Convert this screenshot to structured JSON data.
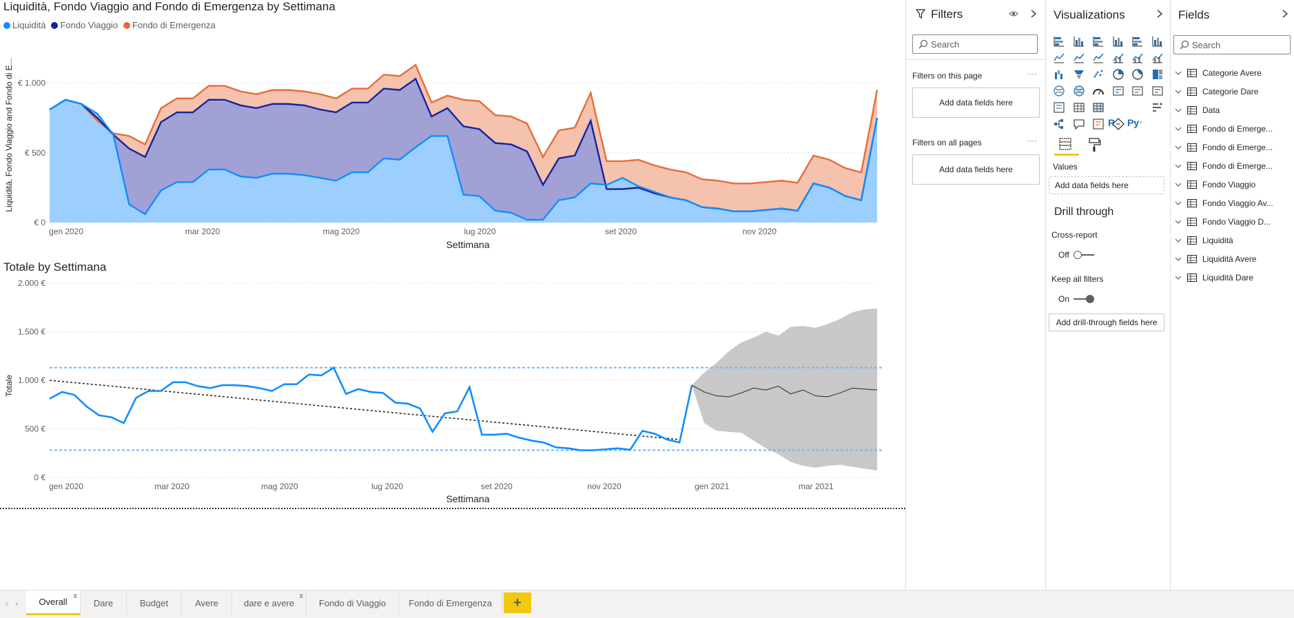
{
  "charts": {
    "top": {
      "title": "Liquidità, Fondo Viaggio and Fondo di Emergenza by Settimana",
      "xlabel": "Settimana",
      "ylabel": "Liquidità, Fondo Viaggio and Fondo di E...",
      "legend": [
        "Liquidità",
        "Fondo Viaggio",
        "Fondo di Emergenza"
      ],
      "yticks": [
        "€ 1.000",
        "€ 500",
        "€ 0"
      ],
      "xticks": [
        "gen 2020",
        "mar 2020",
        "mag 2020",
        "lug 2020",
        "set 2020",
        "nov 2020"
      ]
    },
    "bottom": {
      "title": "Totale by Settimana",
      "xlabel": "Settimana",
      "ylabel": "Totale",
      "yticks": [
        "2.000 €",
        "1.500 €",
        "1.000 €",
        "500 €",
        "0 €"
      ],
      "xticks": [
        "gen 2020",
        "mar 2020",
        "mag 2020",
        "lug 2020",
        "set 2020",
        "nov 2020",
        "gen 2021",
        "mar 2021"
      ]
    }
  },
  "chart_data": [
    {
      "type": "area",
      "title": "Liquidità, Fondo Viaggio and Fondo di Emergenza by Settimana",
      "xlabel": "Settimana",
      "ylabel": "Liquidità, Fondo Viaggio and Fondo di E...",
      "ylim": [
        0,
        1200
      ],
      "legend": "top-left",
      "x": [
        "2020-01-01",
        "2020-01-08",
        "2020-01-15",
        "2020-01-22",
        "2020-01-29",
        "2020-02-05",
        "2020-02-12",
        "2020-02-19",
        "2020-02-26",
        "2020-03-04",
        "2020-03-11",
        "2020-03-18",
        "2020-03-25",
        "2020-04-01",
        "2020-04-08",
        "2020-04-15",
        "2020-04-22",
        "2020-04-29",
        "2020-05-06",
        "2020-05-13",
        "2020-05-20",
        "2020-05-27",
        "2020-06-03",
        "2020-06-10",
        "2020-06-17",
        "2020-06-24",
        "2020-07-01",
        "2020-07-08",
        "2020-07-15",
        "2020-07-22",
        "2020-07-29",
        "2020-08-05",
        "2020-08-12",
        "2020-08-19",
        "2020-08-26",
        "2020-09-02",
        "2020-09-09",
        "2020-09-16",
        "2020-09-23",
        "2020-09-30",
        "2020-10-07",
        "2020-10-14",
        "2020-10-21",
        "2020-10-28",
        "2020-11-04",
        "2020-11-11",
        "2020-11-18",
        "2020-11-25",
        "2020-12-02",
        "2020-12-09",
        "2020-12-16",
        "2020-12-23",
        "2020-12-30"
      ],
      "series": [
        {
          "name": "Liquidità",
          "color": "#118DFF",
          "values": [
            810,
            880,
            850,
            780,
            630,
            130,
            60,
            230,
            290,
            290,
            380,
            380,
            330,
            320,
            350,
            350,
            340,
            320,
            300,
            360,
            360,
            460,
            450,
            540,
            620,
            620,
            200,
            190,
            85,
            70,
            20,
            20,
            160,
            180,
            280,
            270,
            320,
            260,
            220,
            180,
            160,
            110,
            100,
            80,
            80,
            90,
            100,
            85,
            280,
            250,
            190,
            160,
            750
          ]
        },
        {
          "name": "Fondo Viaggio",
          "color": "#12239E",
          "values": [
            810,
            880,
            850,
            750,
            630,
            530,
            470,
            720,
            790,
            790,
            880,
            880,
            840,
            820,
            850,
            850,
            840,
            810,
            790,
            860,
            860,
            960,
            950,
            1030,
            760,
            820,
            690,
            670,
            570,
            560,
            510,
            270,
            460,
            480,
            730,
            240,
            240,
            250,
            210,
            180,
            160,
            110,
            100,
            80,
            80,
            90,
            100,
            85,
            280,
            250,
            190,
            160,
            750
          ]
        },
        {
          "name": "Fondo di Emergenza",
          "color": "#E66C37",
          "values": [
            810,
            880,
            850,
            730,
            640,
            620,
            560,
            820,
            890,
            890,
            980,
            980,
            940,
            920,
            950,
            950,
            940,
            920,
            890,
            960,
            960,
            1060,
            1050,
            1130,
            860,
            910,
            880,
            870,
            770,
            760,
            710,
            470,
            660,
            680,
            930,
            440,
            440,
            450,
            410,
            380,
            360,
            310,
            300,
            280,
            280,
            290,
            300,
            285,
            480,
            450,
            390,
            360,
            950
          ]
        }
      ]
    },
    {
      "type": "line",
      "title": "Totale by Settimana",
      "xlabel": "Settimana",
      "ylabel": "Totale",
      "ylim": [
        0,
        2000
      ],
      "x": [
        "2020-01-01",
        "2020-01-08",
        "2020-01-15",
        "2020-01-22",
        "2020-01-29",
        "2020-02-05",
        "2020-02-12",
        "2020-02-19",
        "2020-02-26",
        "2020-03-04",
        "2020-03-11",
        "2020-03-18",
        "2020-03-25",
        "2020-04-01",
        "2020-04-08",
        "2020-04-15",
        "2020-04-22",
        "2020-04-29",
        "2020-05-06",
        "2020-05-13",
        "2020-05-20",
        "2020-05-27",
        "2020-06-03",
        "2020-06-10",
        "2020-06-17",
        "2020-06-24",
        "2020-07-01",
        "2020-07-08",
        "2020-07-15",
        "2020-07-22",
        "2020-07-29",
        "2020-08-05",
        "2020-08-12",
        "2020-08-19",
        "2020-08-26",
        "2020-09-02",
        "2020-09-09",
        "2020-09-16",
        "2020-09-23",
        "2020-09-30",
        "2020-10-07",
        "2020-10-14",
        "2020-10-21",
        "2020-10-28",
        "2020-11-04",
        "2020-11-11",
        "2020-11-18",
        "2020-11-25",
        "2020-12-02",
        "2020-12-09",
        "2020-12-16",
        "2020-12-23",
        "2020-12-30"
      ],
      "series": [
        {
          "name": "Totale",
          "color": "#118DFF",
          "values": [
            810,
            880,
            850,
            730,
            640,
            620,
            560,
            820,
            890,
            890,
            980,
            980,
            940,
            920,
            950,
            950,
            940,
            920,
            890,
            960,
            960,
            1060,
            1050,
            1130,
            860,
            910,
            880,
            870,
            770,
            760,
            710,
            470,
            660,
            680,
            930,
            440,
            440,
            450,
            410,
            380,
            360,
            310,
            300,
            280,
            280,
            290,
            300,
            285,
            480,
            450,
            390,
            360,
            950
          ]
        }
      ],
      "reference_lines": {
        "max": 1130,
        "min": 280,
        "color": "#118DFF"
      },
      "trend": {
        "start": {
          "x": "2020-01-01",
          "y": 1000
        },
        "end": {
          "x": "2020-12-23",
          "y": 390
        }
      },
      "forecast": {
        "x": [
          "2020-12-30",
          "2021-01-06",
          "2021-01-13",
          "2021-01-20",
          "2021-01-27",
          "2021-02-03",
          "2021-02-10",
          "2021-02-17",
          "2021-02-24",
          "2021-03-03",
          "2021-03-10",
          "2021-03-17",
          "2021-03-24",
          "2021-03-31",
          "2021-04-07",
          "2021-04-14"
        ],
        "values": [
          950,
          880,
          840,
          830,
          870,
          920,
          900,
          940,
          860,
          900,
          840,
          830,
          870,
          920,
          910,
          900
        ],
        "upper": [
          950,
          1080,
          1180,
          1300,
          1390,
          1440,
          1500,
          1460,
          1550,
          1560,
          1540,
          1580,
          1630,
          1700,
          1730,
          1740
        ],
        "lower": [
          950,
          560,
          480,
          470,
          460,
          380,
          300,
          240,
          160,
          120,
          100,
          120,
          130,
          110,
          90,
          70
        ],
        "band_color": "#C8C8C8"
      }
    }
  ],
  "filters_pane": {
    "title": "Filters",
    "search_placeholder": "Search",
    "on_this_page": "Filters on this page",
    "on_all_pages": "Filters on all pages",
    "add_fields": "Add data fields here"
  },
  "visualizations_pane": {
    "title": "Visualizations",
    "values_label": "Values",
    "values_drop": "Add data fields here",
    "drill_through": "Drill through",
    "cross_report": "Cross-report",
    "cross_report_state": "Off",
    "keep_all_filters": "Keep all filters",
    "keep_all_filters_state": "On",
    "drill_drop": "Add drill-through fields here",
    "more": "···"
  },
  "fields_pane": {
    "title": "Fields",
    "search_placeholder": "Search",
    "tables": [
      "Categorie Avere",
      "Categorie Dare",
      "Data",
      "Fondo di Emerge...",
      "Fondo di Emerge...",
      "Fondo di Emerge...",
      "Fondo Viaggio",
      "Fondo Viaggio Av...",
      "Fondo Viaggio D...",
      "Liquidità",
      "Liquidità Avere",
      "Liquidità Dare"
    ]
  },
  "page_tabs": [
    "Overall",
    "Dare",
    "Budget",
    "Avere",
    "dare e avere",
    "Fondo di Viaggio",
    "Fondo di Emergenza"
  ],
  "active_tab": "Overall",
  "add_page": "+",
  "close_mark": "x"
}
